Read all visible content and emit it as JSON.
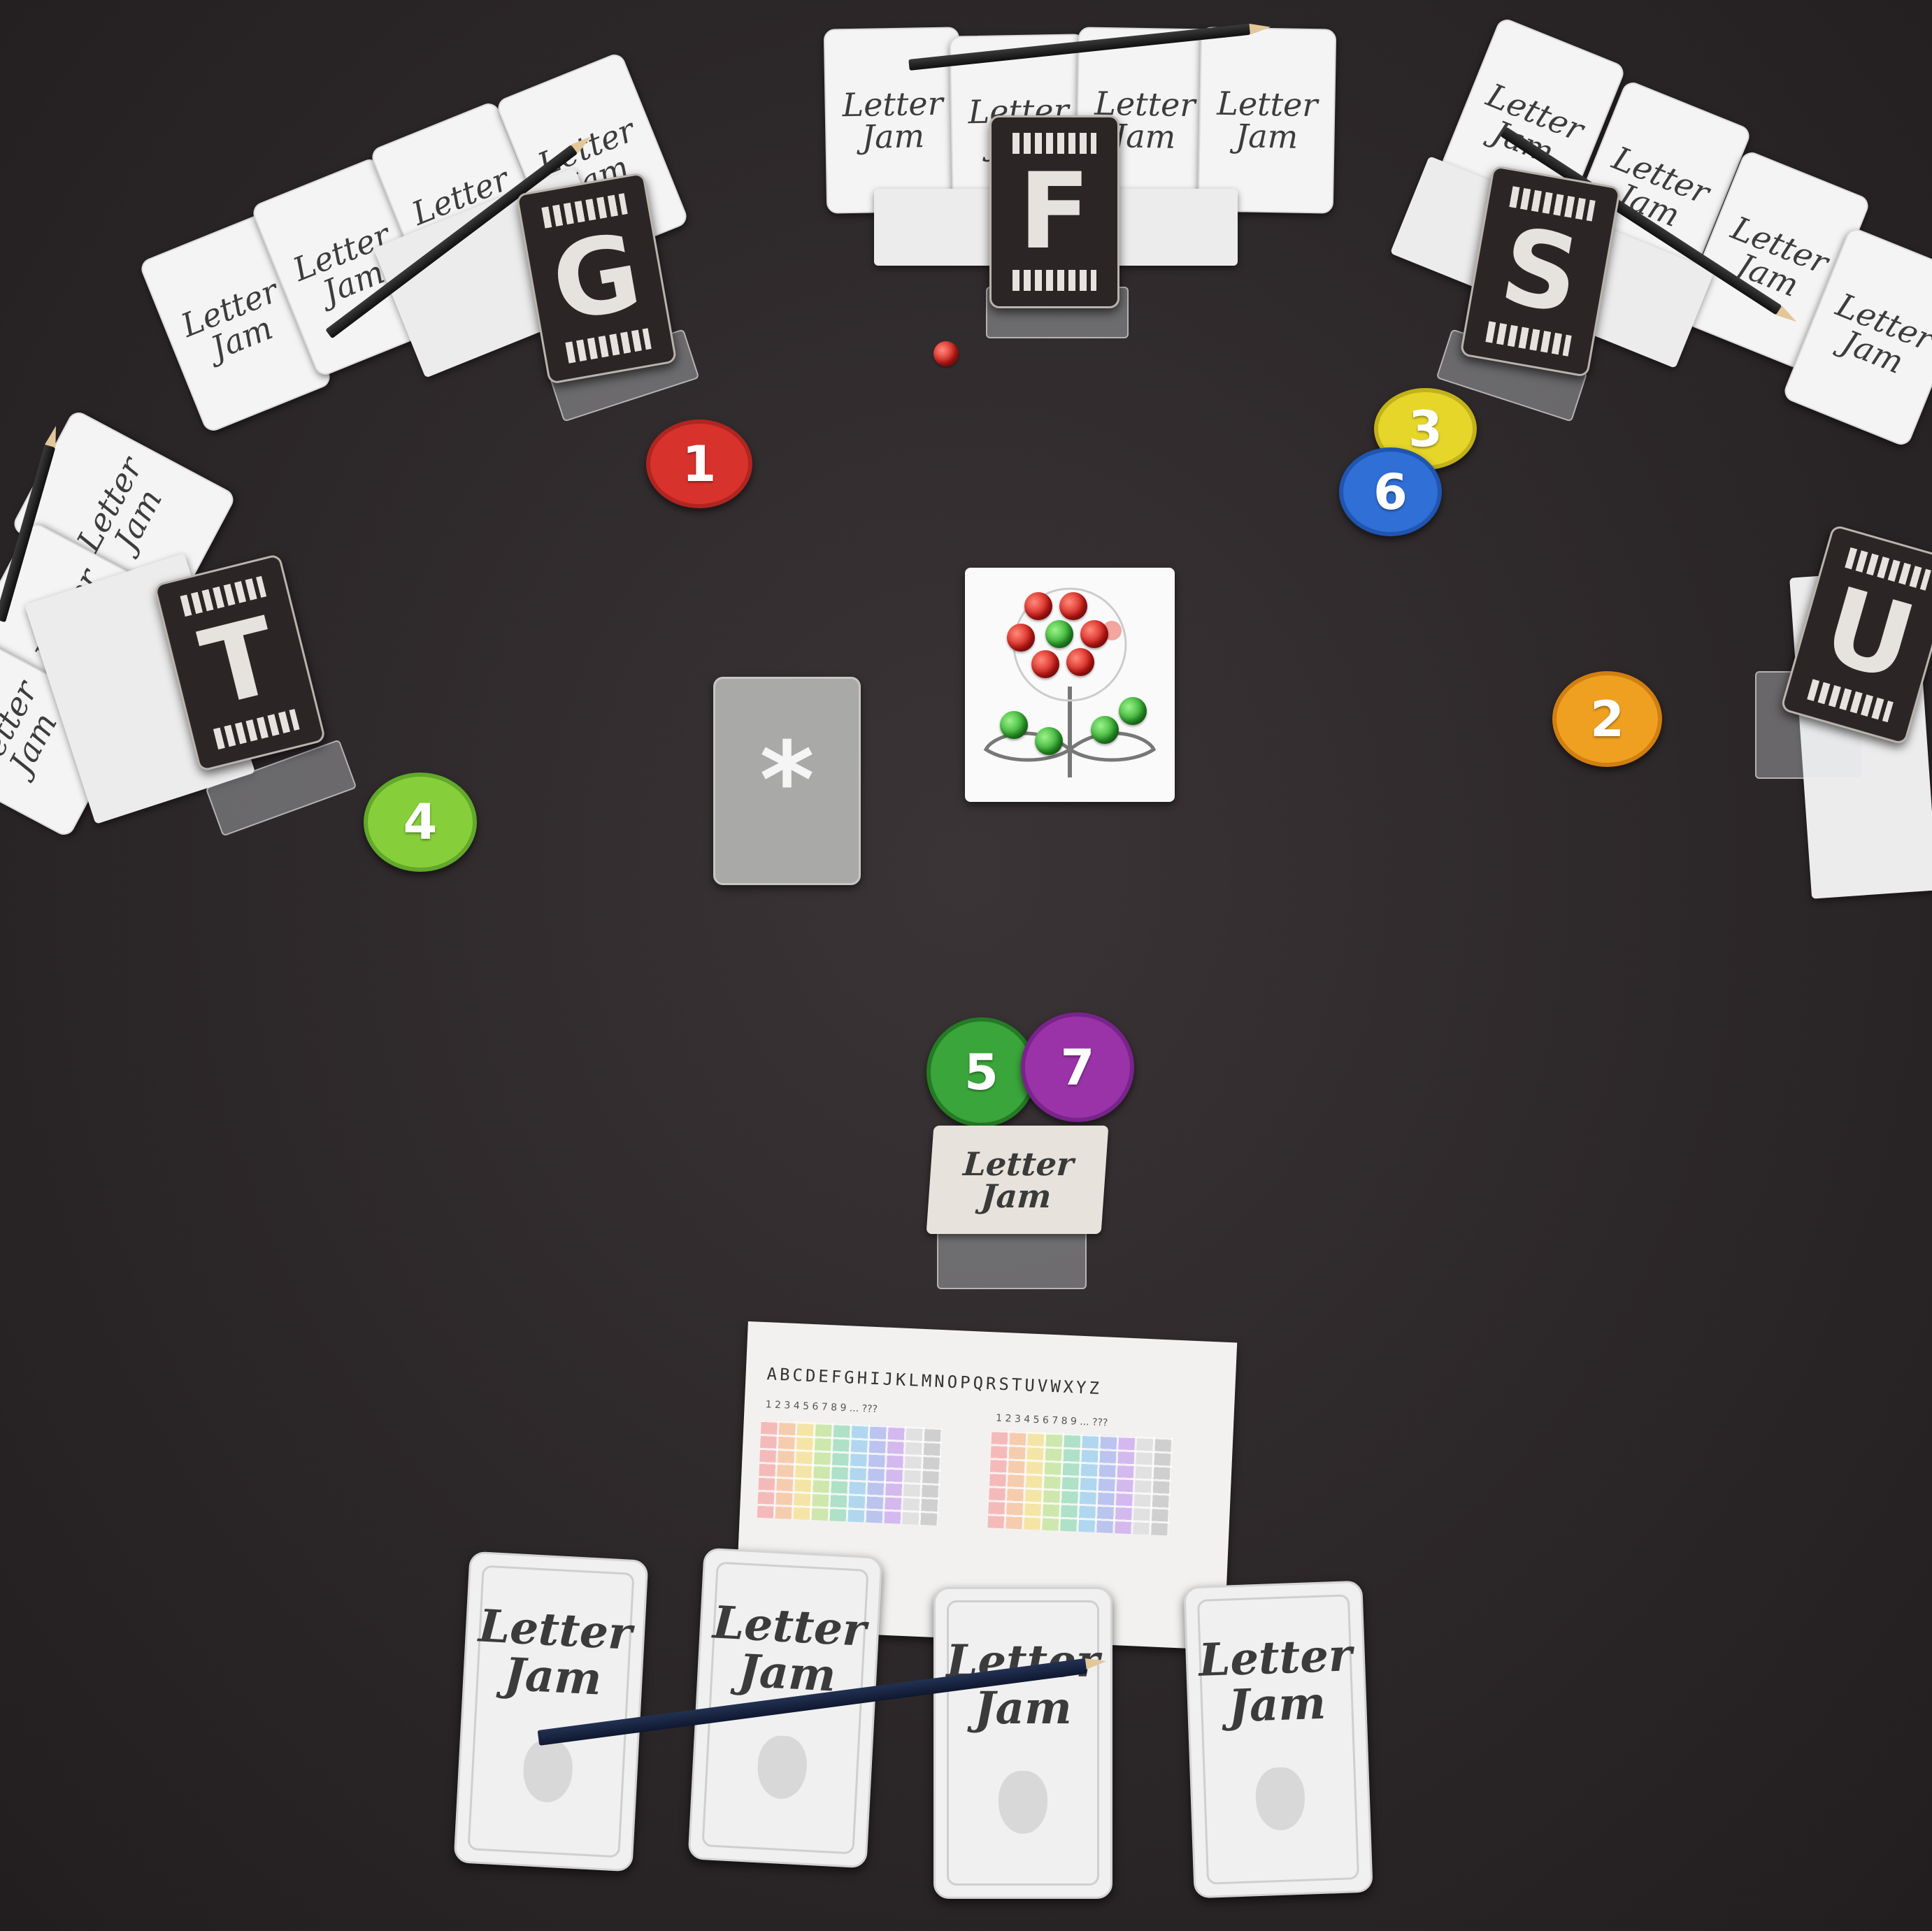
{
  "game": {
    "logo_text": "Letter Jam",
    "logo_line1": "Letter",
    "logo_line2": "Jam"
  },
  "players": [
    {
      "id": "top-left",
      "letter": "G"
    },
    {
      "id": "top-center",
      "letter": "F"
    },
    {
      "id": "top-right",
      "letter": "S"
    },
    {
      "id": "left",
      "letter": "T"
    },
    {
      "id": "right",
      "letter": "U"
    }
  ],
  "tokens": [
    {
      "number": "1",
      "color": "#d8322c"
    },
    {
      "number": "2",
      "color": "#f0a020"
    },
    {
      "number": "3",
      "color": "#e6d62a"
    },
    {
      "number": "4",
      "color": "#86cf3a"
    },
    {
      "number": "5",
      "color": "#3aa53a"
    },
    {
      "number": "6",
      "color": "#2f6fd6"
    },
    {
      "number": "7",
      "color": "#9a33a8"
    }
  ],
  "wild_card": {
    "symbol": "*"
  },
  "score_sheet": {
    "alphabet": "ABCDEFGHIJKLMNOPQRSTUVWXYZ",
    "columns_left": "1 2 3 4 5 6 7 8 9 ... ???",
    "columns_right": "1 2 3 4 5 6 7 8 9 ... ???"
  },
  "tiny_sheet_letters": "ABCDEFG",
  "colors": {
    "table": "#2c2729",
    "card": "#f4f4f4",
    "letter_card": "#2b2625"
  }
}
